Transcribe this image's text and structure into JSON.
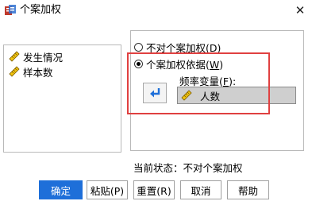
{
  "window": {
    "title": "个案加权",
    "close_glyph": "✕"
  },
  "variables": [
    {
      "label": "发生情况",
      "icon": "ruler-pencil-icon"
    },
    {
      "label": "样本数",
      "icon": "ruler-pencil-icon"
    }
  ],
  "options": {
    "no_weight": {
      "label": "不对个案加权(",
      "mnemonic": "D",
      "suffix": ")",
      "checked": false
    },
    "weight_by": {
      "label": "个案加权依据(",
      "mnemonic": "W",
      "suffix": ")",
      "checked": true
    }
  },
  "frequency": {
    "label": "频率变量(",
    "mnemonic": "F",
    "suffix": "):",
    "value": "人数",
    "icon": "ruler-pencil-icon"
  },
  "status": {
    "text": "当前状态：不对个案加权"
  },
  "buttons": {
    "ok": "确定",
    "paste": "粘贴(P)",
    "reset": "重置(R)",
    "cancel": "取消",
    "help": "帮助"
  },
  "colors": {
    "accent": "#1e6fd9",
    "highlight": "#e04040",
    "field_bg": "#cfcfcf"
  }
}
